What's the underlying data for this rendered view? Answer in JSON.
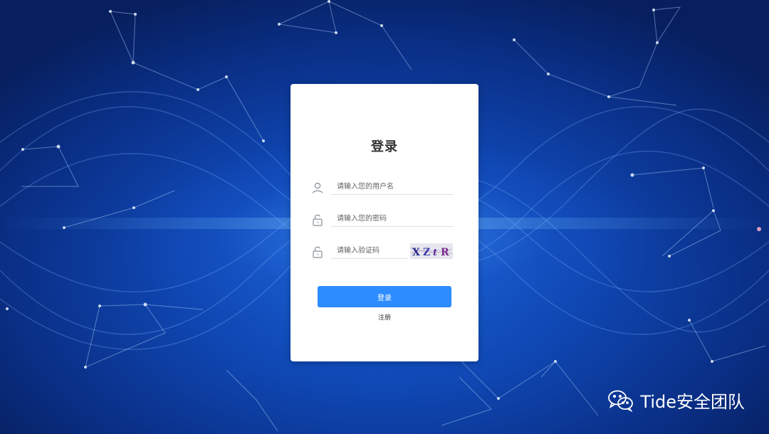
{
  "login": {
    "title": "登录",
    "username_placeholder": "请输入您的用户名",
    "password_placeholder": "请输入您的密码",
    "captcha_placeholder": "请输入验证码",
    "captcha_text": "XZtR",
    "login_button": "登录",
    "register_link": "注册"
  },
  "watermark": {
    "text": "Tide安全团队"
  },
  "colors": {
    "primary_button": "#2d8cff",
    "background_deep": "#0a2f86",
    "card": "#ffffff"
  },
  "icons": {
    "username": "user-icon",
    "password": "lock-icon",
    "captcha": "lock-icon",
    "watermark": "wechat-icon"
  }
}
